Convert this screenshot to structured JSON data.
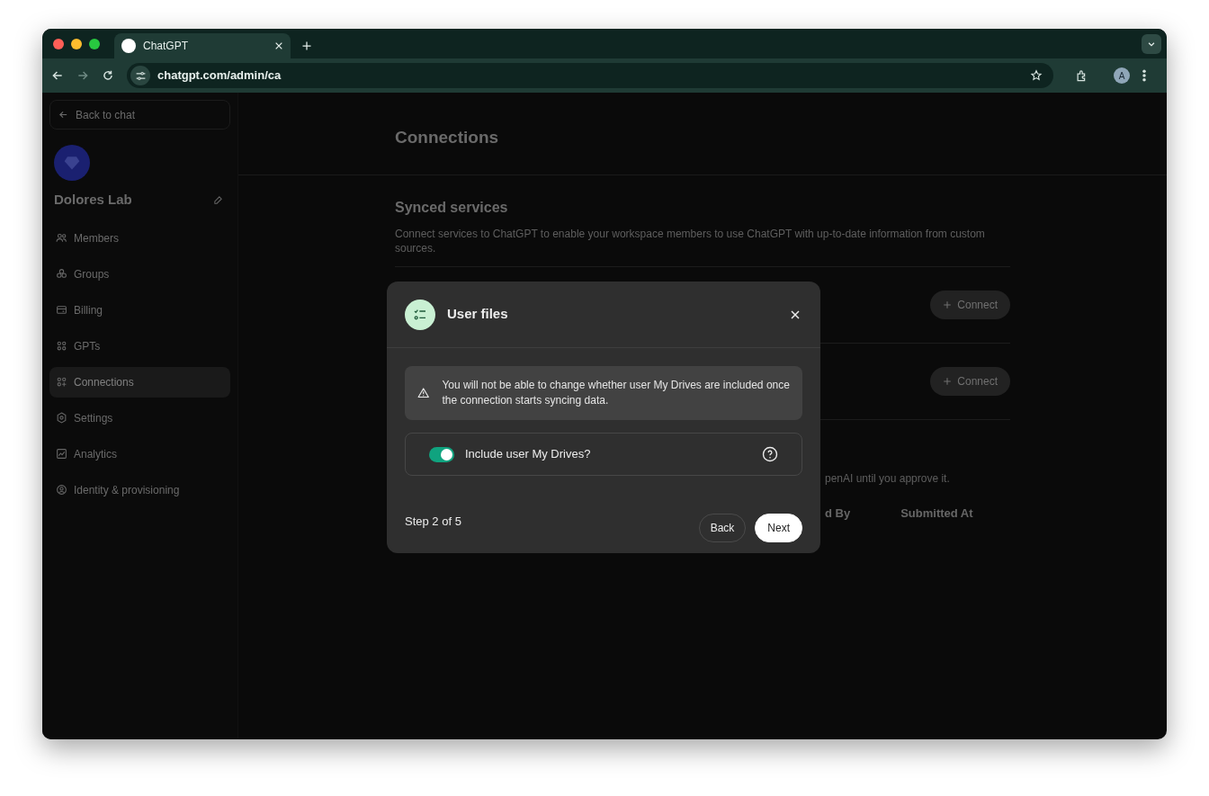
{
  "browser": {
    "tab_title": "ChatGPT",
    "url": "chatgpt.com/admin/ca",
    "avatar": "A"
  },
  "sidebar": {
    "back_label": "Back to chat",
    "workspace": "Dolores Lab",
    "items": [
      {
        "label": "Members",
        "selected": false
      },
      {
        "label": "Groups",
        "selected": false
      },
      {
        "label": "Billing",
        "selected": false
      },
      {
        "label": "GPTs",
        "selected": false
      },
      {
        "label": "Connections",
        "selected": true
      },
      {
        "label": "Settings",
        "selected": false
      },
      {
        "label": "Analytics",
        "selected": false
      },
      {
        "label": "Identity & provisioning",
        "selected": false
      }
    ]
  },
  "main": {
    "title": "Connections",
    "section_title": "Synced services",
    "description": "Connect services to ChatGPT to enable your workspace members to use ChatGPT with up-to-date information from custom sources.",
    "services": [
      {
        "button": "Connect"
      },
      {
        "button": "Connect"
      }
    ],
    "partial_text": "penAI until you approve it.",
    "columns": [
      "d By",
      "Submitted At"
    ]
  },
  "modal": {
    "title": "User files",
    "warning": "You will not be able to change whether user My Drives are included once the connection starts syncing data.",
    "toggle": {
      "label": "Include user My Drives?",
      "on": true
    },
    "step": "Step 2 of 5",
    "back": "Back",
    "next": "Next"
  }
}
